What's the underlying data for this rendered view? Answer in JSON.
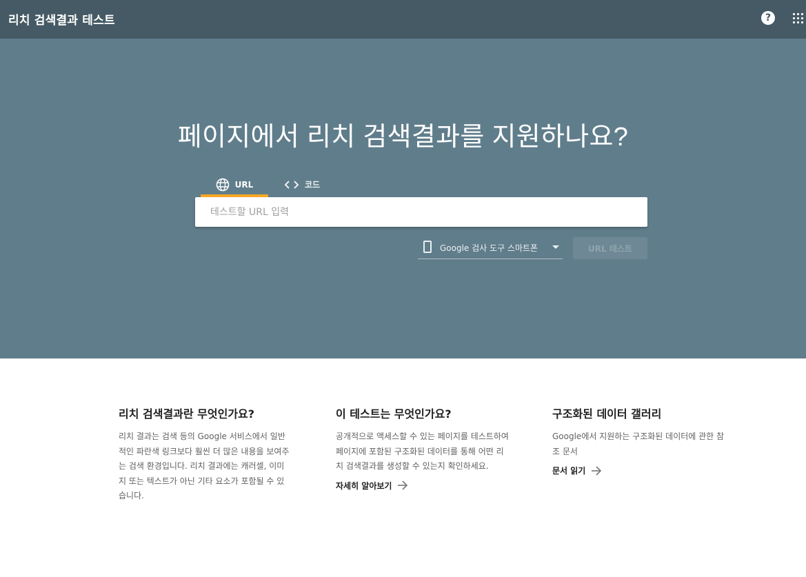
{
  "header": {
    "app_title": "리치 검색결과 테스트",
    "help_icon": "help-icon",
    "apps_icon": "apps-grid-icon"
  },
  "hero": {
    "title": "페이지에서 리치 검색결과를 지원하나요?",
    "tabs": [
      {
        "label": "URL",
        "icon": "globe-icon",
        "selected": true
      },
      {
        "label": "코드",
        "icon": "code-icon",
        "selected": false
      }
    ],
    "url_input": {
      "placeholder": "테스트할 URL 입력",
      "value": ""
    },
    "device_select": {
      "icon": "smartphone-icon",
      "selected": "Google 검사 도구 스마트폰"
    },
    "test_button": "URL 테스트"
  },
  "info": [
    {
      "title": "리치 검색결과란 무엇인가요?",
      "body": "리치 결과는 검색 등의 Google 서비스에서 일반적인 파란색 링크보다 훨씬 더 많은 내용을 보여주는 검색 환경입니다. 리치 결과에는 캐러셀, 이미지 또는 텍스트가 아닌 기타 요소가 포함될 수 있습니다.",
      "link": ""
    },
    {
      "title": "이 테스트는 무엇인가요?",
      "body": "공개적으로 액세스할 수 있는 페이지를 테스트하여 페이지에 포함된 구조화된 데이터를 통해 어떤 리치 검색결과를 생성할 수 있는지 확인하세요.",
      "link": "자세히 알아보기"
    },
    {
      "title": "구조화된 데이터 갤러리",
      "body": "Google에서 지원하는 구조화된 데이터에 관한 참조 문서",
      "link": "문서 읽기"
    }
  ],
  "colors": {
    "topbar": "#455a64",
    "hero": "#607d8b",
    "tab_indicator": "#f9a825"
  }
}
